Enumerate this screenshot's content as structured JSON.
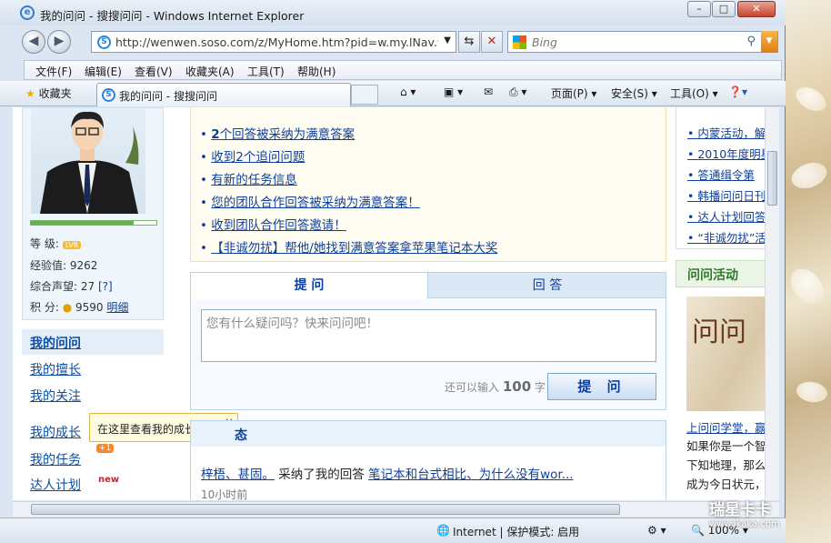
{
  "window": {
    "title": "我的问问 - 搜搜问问 - Windows Internet Explorer"
  },
  "address": {
    "url": "http://wenwen.soso.com/z/MyHome.htm?pid=w.my.lNav.wen",
    "search_placeholder": "Bing"
  },
  "menu": [
    "文件(F)",
    "编辑(E)",
    "查看(V)",
    "收藏夹(A)",
    "工具(T)",
    "帮助(H)"
  ],
  "favorites": {
    "label": "收藏夹",
    "tab_title": "我的问问 - 搜搜问问"
  },
  "commands": [
    "页面(P)",
    "安全(S)",
    "工具(O)"
  ],
  "profile": {
    "level_label": "等    级:",
    "level_badge": "LV8",
    "exp_label": "经验值:",
    "exp_value": "9262",
    "rep_label": "综合声望:",
    "rep_value": "27",
    "rep_help": "[?]",
    "points_label": "积    分:",
    "points_value": "9590",
    "points_link": "明细",
    "progress": 0.82
  },
  "nav": {
    "heading": "我的问问",
    "items": [
      "我的擅长",
      "我的关注",
      "我的成长",
      "我的任务",
      "达人计划"
    ],
    "task_badge": "+1",
    "new_tag": "new"
  },
  "tooltip": {
    "text": "在这里查看我的成长详情。"
  },
  "notices": [
    {
      "prefix": "2",
      "text": "个回答被采纳为满意答案"
    },
    {
      "prefix": "收到2",
      "text": "个追问问题"
    },
    {
      "prefix": "",
      "text": "有新的任务信息"
    },
    {
      "prefix": "",
      "text": "您的团队合作回答被采纳为满意答案！"
    },
    {
      "prefix": "",
      "text": "收到团队合作回答邀请！"
    },
    {
      "prefix": "",
      "text": "【非诚勿扰】帮他/她找到满意答案拿苹果笔记本大奖"
    }
  ],
  "ask": {
    "tab_ask": "提 问",
    "tab_answer": "回 答",
    "placeholder": "您有什么疑问吗？快来问问吧！",
    "remain_prefix": "还可以输入",
    "remain_count": "100",
    "remain_suffix": "字",
    "submit": "提 问"
  },
  "feed": {
    "heading": "态",
    "user": "梓梧、甚固。",
    "action": " 采纳了我的回答 ",
    "question": "笔记本和台式相比、为什么没有wor...",
    "time": "10小时前"
  },
  "right": {
    "items": [
      "内蒙活动，解",
      "2010年度明星",
      "答通缉令第",
      "韩播问问日刊",
      "达人计划回答",
      "“非诚勿扰”活"
    ],
    "activity_heading": "问问活动",
    "image_text": "问问",
    "link1": "上问问学堂，赢",
    "line2": "如果你是一个智",
    "line3": "下知地理，那么",
    "line4": "成为今日状元，"
  },
  "status": {
    "zone": "Internet | 保护模式: 启用",
    "zoom": "100%"
  },
  "watermark": {
    "brand": "瑞星卡卡",
    "url": "www.ikaka.com"
  }
}
